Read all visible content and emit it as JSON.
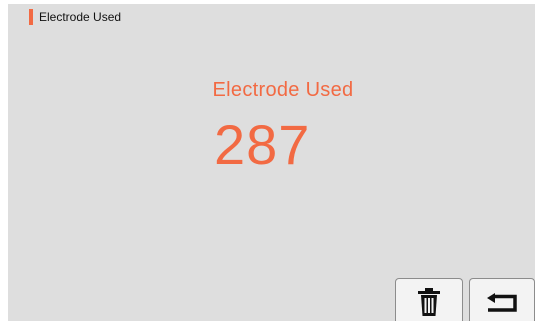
{
  "header": {
    "title": "Electrode Used"
  },
  "main": {
    "label": "Electrode Used",
    "value": "287"
  },
  "buttons": {
    "delete_icon": "trash-icon",
    "back_icon": "return-arrow-icon"
  },
  "colors": {
    "accent": "#f26a43",
    "screen_background": "#dedede",
    "button_background": "#f3f3f3"
  }
}
